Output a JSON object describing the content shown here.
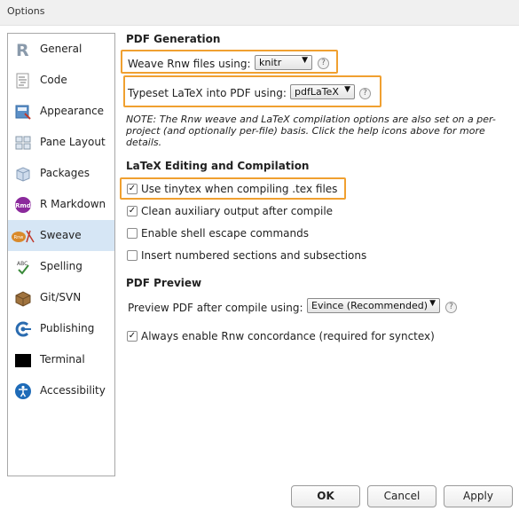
{
  "window": {
    "title": "Options"
  },
  "sidebar": {
    "items": [
      {
        "label": "General",
        "icon": "r-logo-icon"
      },
      {
        "label": "Code",
        "icon": "code-document-icon"
      },
      {
        "label": "Appearance",
        "icon": "appearance-icon"
      },
      {
        "label": "Pane Layout",
        "icon": "pane-layout-icon"
      },
      {
        "label": "Packages",
        "icon": "packages-icon"
      },
      {
        "label": "R Markdown",
        "icon": "rmarkdown-icon"
      },
      {
        "label": "Sweave",
        "icon": "sweave-icon",
        "selected": true
      },
      {
        "label": "Spelling",
        "icon": "spelling-icon"
      },
      {
        "label": "Git/SVN",
        "icon": "git-svn-icon"
      },
      {
        "label": "Publishing",
        "icon": "publishing-icon"
      },
      {
        "label": "Terminal",
        "icon": "terminal-icon"
      },
      {
        "label": "Accessibility",
        "icon": "accessibility-icon"
      }
    ]
  },
  "pdf_generation": {
    "title": "PDF Generation",
    "weave_label": "Weave Rnw files using:",
    "weave_value": "knitr",
    "typeset_label": "Typeset LaTeX into PDF using:",
    "typeset_value": "pdfLaTeX",
    "note": "NOTE: The Rnw weave and LaTeX compilation options are also set on a per-project (and optionally per-file) basis. Click the help icons above for more details."
  },
  "latex_editing": {
    "title": "LaTeX Editing and Compilation",
    "options": [
      {
        "label": "Use tinytex when compiling .tex files",
        "checked": true
      },
      {
        "label": "Clean auxiliary output after compile",
        "checked": true
      },
      {
        "label": "Enable shell escape commands",
        "checked": false
      },
      {
        "label": "Insert numbered sections and subsections",
        "checked": false
      }
    ]
  },
  "pdf_preview": {
    "title": "PDF Preview",
    "preview_label": "Preview PDF after compile using:",
    "preview_value": "Evince (Recommended)",
    "concordance_label": "Always enable Rnw concordance (required for synctex)",
    "concordance_checked": true
  },
  "help_glyph": "?",
  "check_glyph": "✓",
  "dropdown_glyph": "▼",
  "buttons": {
    "ok": "OK",
    "cancel": "Cancel",
    "apply": "Apply"
  },
  "colors": {
    "highlight": "#f0a030",
    "selected_nav": "#d6e6f5"
  }
}
